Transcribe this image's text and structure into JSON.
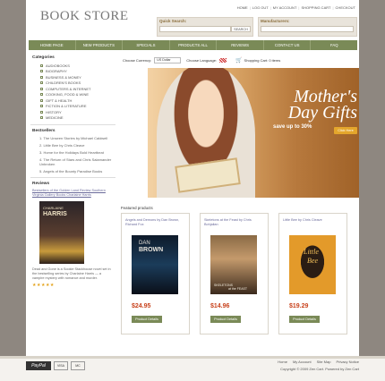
{
  "logo": "BOOK STORE",
  "topnav": [
    "HOME",
    "LOG OUT",
    "MY ACCOUNT",
    "SHOPPING CART",
    "CHECKOUT"
  ],
  "quick_search": {
    "label": "Quick Search:",
    "button": "SEARCH"
  },
  "manufacturers": {
    "label": "Manufacturers:"
  },
  "mainnav": [
    "HOME PAGE",
    "NEW PRODUCTS",
    "SPECIALS",
    "PRODUCTS ALL",
    "REVIEWS",
    "CONTACT US",
    "FAQ"
  ],
  "categories": {
    "title": "Categories",
    "items": [
      "AUDIOBOOKS",
      "BIOGRAPHY",
      "BUSINESS & MONEY",
      "CHILDREN'S BOOKS",
      "COMPUTERS & INTERNET",
      "COOKING, FOOD & WINE",
      "GIFT & HEALTH",
      "FICTION & LITERATURE",
      "HISTORY",
      "MEDICINE"
    ]
  },
  "bestsellers": {
    "title": "Bestsellers",
    "items": [
      "1. The Unseen Stories by Michael Caldwell",
      "2. Little Bee by Chris Cleave",
      "3. Home for the Holidays Bold Heartbeat",
      "4. The Return of Stars and Chris Salamander Unbroken",
      "5. Angels of the Bounty Paradise Books"
    ]
  },
  "review": {
    "title": "Reviews",
    "link": "Bestsellers of the Golden Land Review Southern Virginia Gallery Books Charlaine Harris",
    "cover_author": "CHARLAINE",
    "cover_name": "HARRIS",
    "body": "Dead and Gone is a Sookie Stackhouse novel set in the bestselling series by Charlaine Harris — a vampire mystery with romance and murder.",
    "stars": "★★★★★"
  },
  "mainbar": {
    "currency_label": "Choose Currency:",
    "currency_value": "US Dollar",
    "language_label": "Choose Language:",
    "cart": "Shopping Cart: 0 items"
  },
  "banner": {
    "headline": "Mother's Day Gifts",
    "sub": "save up to 30%",
    "button": "Click Here"
  },
  "featured_title": "Featured products",
  "products": [
    {
      "title": "Angels and Demons by Dan Brown, Richard Fox",
      "cover_top": "DAN",
      "cover_mid": "BROWN",
      "price": "$24.95",
      "button": "Product Details"
    },
    {
      "title": "Skeletons at the Feast by Chris Bohjalian",
      "cover_top": "SKELETONS",
      "cover_mid": "at the FEAST",
      "price": "$14.96",
      "button": "Product Details"
    },
    {
      "title": "Little Bee by Chris Cleave",
      "cover_top": "Little",
      "cover_mid": "Bee",
      "price": "$19.29",
      "button": "Product Details"
    }
  ],
  "footer": {
    "links": [
      "Home",
      "My Account",
      "Site Map",
      "Privacy Notice"
    ],
    "copyright": "Copyright © 2009 Zen Cart. Powered by Zen Cart",
    "payments": [
      "PayPal",
      "VISA",
      "MC"
    ]
  }
}
